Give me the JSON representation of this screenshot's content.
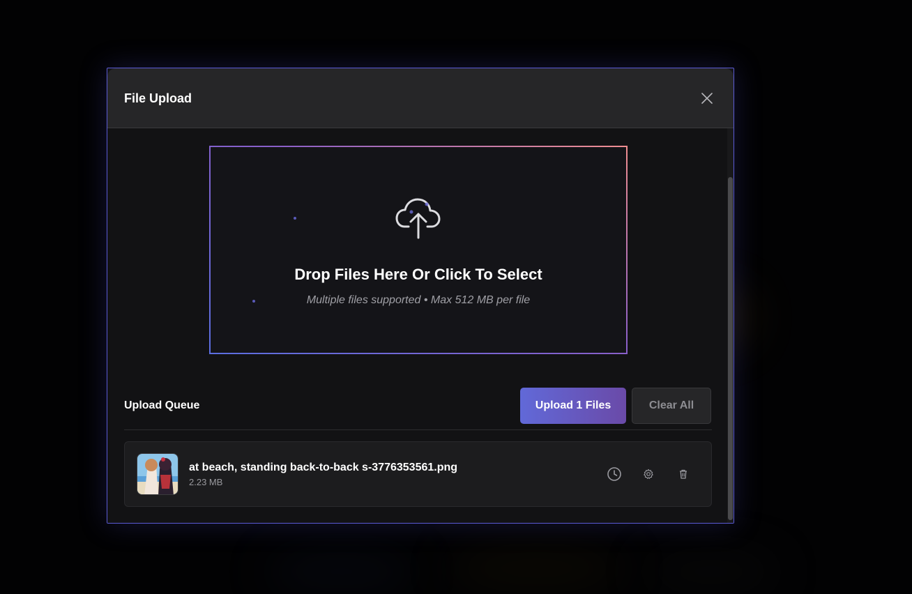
{
  "modal": {
    "title": "File Upload",
    "close_icon": "close-icon"
  },
  "dropzone": {
    "icon": "cloud-upload-icon",
    "title": "Drop Files Here Or Click To Select",
    "subtitle": "Multiple files supported • Max 512 MB per file",
    "gradient_colors": [
      "#5b6ee0",
      "#8a5fc9",
      "#f08e90"
    ]
  },
  "queue": {
    "title": "Upload Queue",
    "upload_label": "Upload 1 Files",
    "clear_label": "Clear All",
    "files": [
      {
        "name": "at beach, standing back-to-back s-3776353561.png",
        "size": "2.23 MB",
        "actions": [
          "clock-icon",
          "gear-icon",
          "trash-icon"
        ]
      }
    ]
  },
  "colors": {
    "accent": "#6169d8",
    "modal_border": "#5b5bd6",
    "background": "#000000"
  }
}
